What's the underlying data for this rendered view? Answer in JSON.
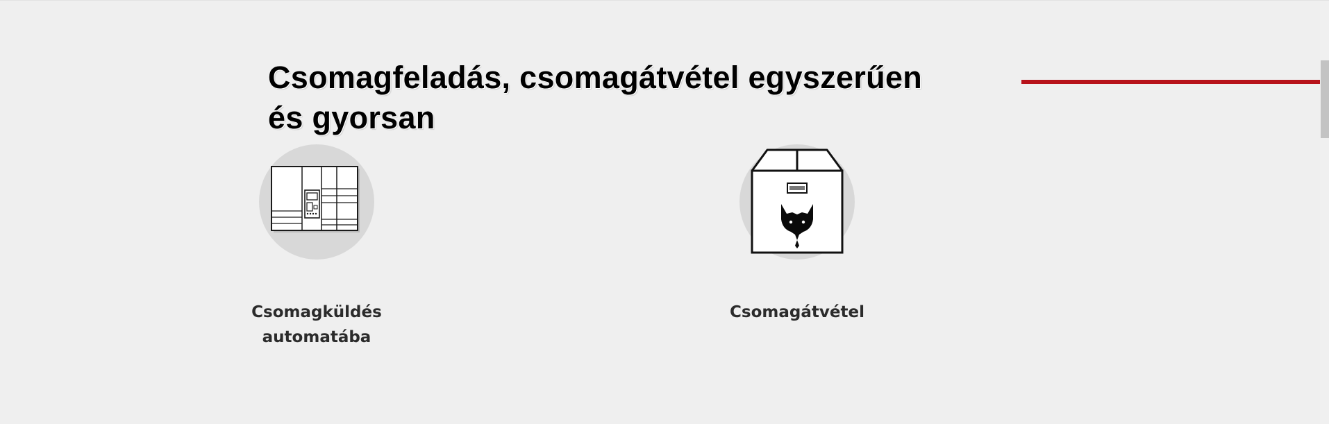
{
  "hero": {
    "title_line1": "Csomagfeladás, csomagátvétel egyszerűen",
    "title_line2": "és gyorsan"
  },
  "services": [
    {
      "label": "Csomagküldés automatába",
      "icon": "parcel-locker-icon"
    },
    {
      "label": "Csomagátvétel",
      "icon": "parcel-box-fox-icon"
    }
  ],
  "colors": {
    "background": "#efefef",
    "accent": "#b7121a",
    "icon_circle": "#d8d8d8",
    "label_text": "#2b2b2b"
  }
}
